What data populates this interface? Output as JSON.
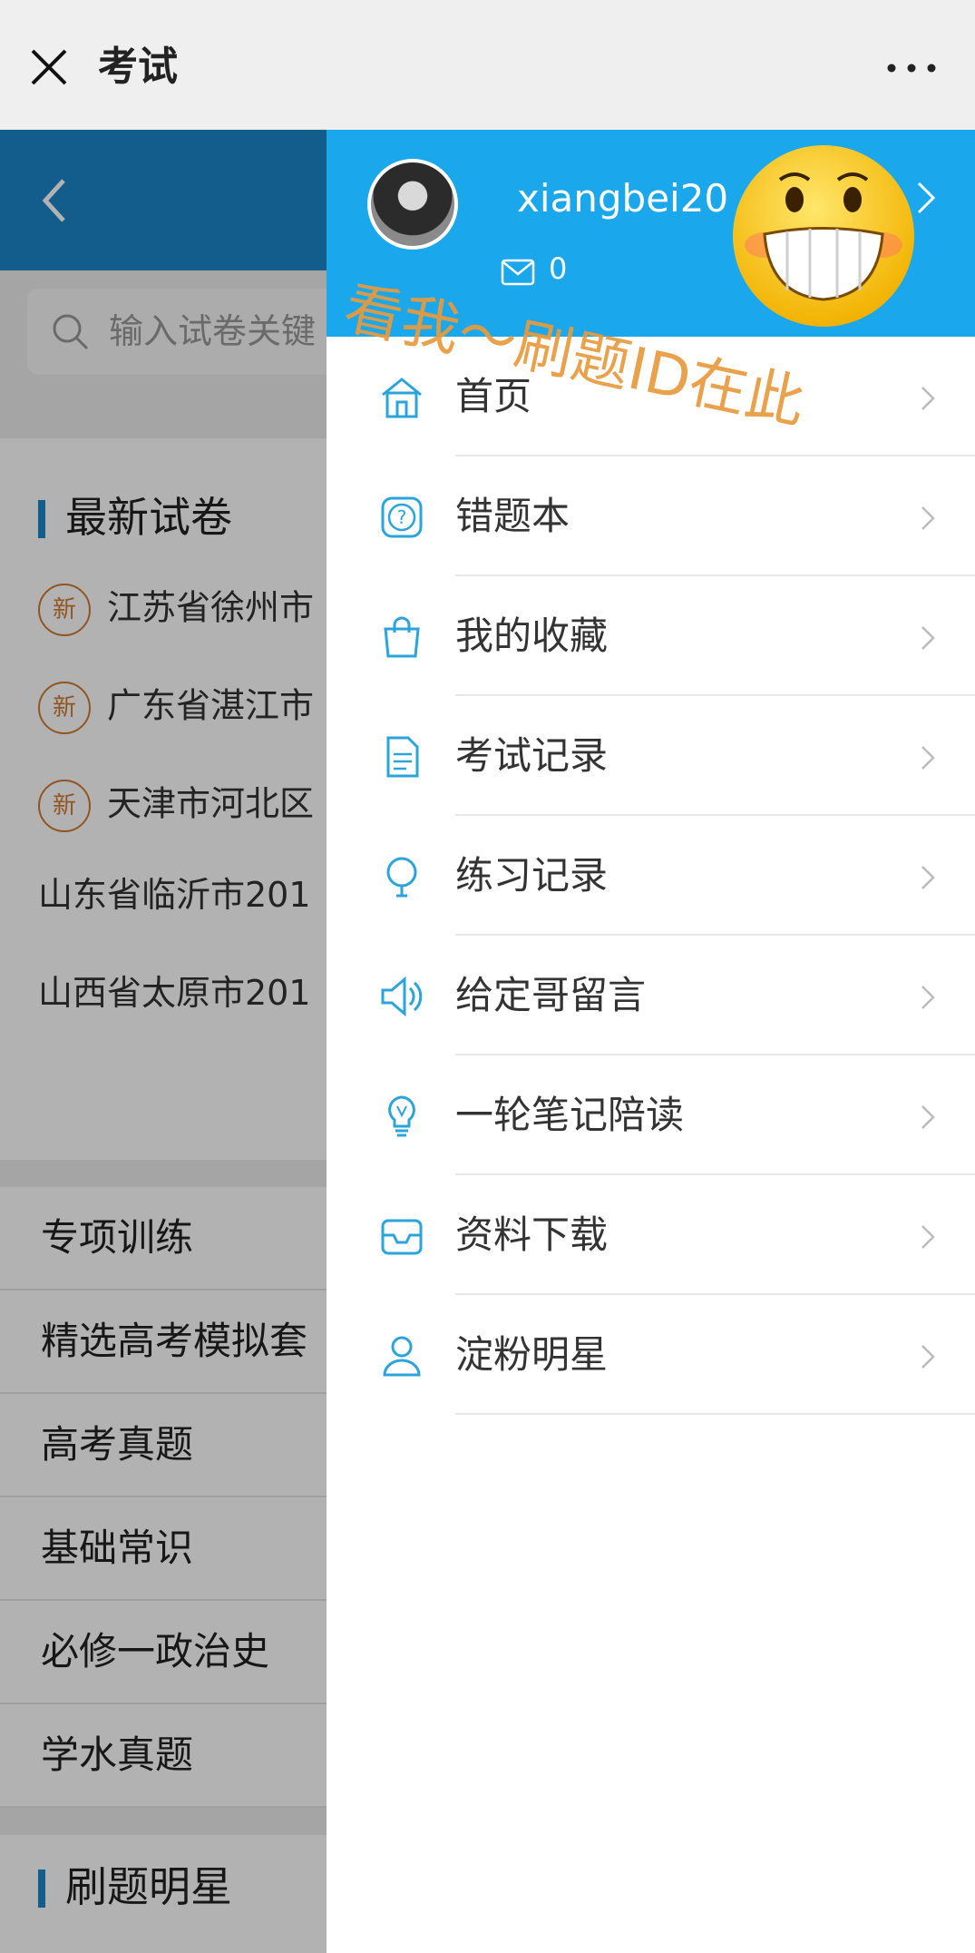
{
  "topbar": {
    "title": "考试"
  },
  "background": {
    "search_placeholder": "输入试卷关键",
    "latest_section_title": "最新试卷",
    "new_badge": "新",
    "papers": [
      {
        "text": "江苏省徐州市",
        "new": true
      },
      {
        "text": "广东省湛江市",
        "new": true
      },
      {
        "text": "天津市河北区",
        "new": true
      },
      {
        "text": "山东省临沂市201",
        "new": false
      },
      {
        "text": "山西省太原市201",
        "new": false
      }
    ],
    "categories": [
      "专项训练",
      "精选高考模拟套",
      "高考真题",
      "基础常识",
      "必修一政治史",
      "学水真题"
    ],
    "bottom_section_title": "刷题明星"
  },
  "drawer": {
    "username": "xiangbei20",
    "mail_count": "0",
    "menu": [
      {
        "label": "首页",
        "icon": "home-icon"
      },
      {
        "label": "错题本",
        "icon": "question-icon"
      },
      {
        "label": "我的收藏",
        "icon": "bag-icon"
      },
      {
        "label": "考试记录",
        "icon": "document-icon"
      },
      {
        "label": "练习记录",
        "icon": "bulb-icon"
      },
      {
        "label": "给定哥留言",
        "icon": "speaker-icon"
      },
      {
        "label": "一轮笔记陪读",
        "icon": "lightbulb-icon"
      },
      {
        "label": "资料下载",
        "icon": "inbox-icon"
      },
      {
        "label": "淀粉明星",
        "icon": "user-icon"
      }
    ]
  },
  "annotation": "看我～刷题ID在此",
  "colors": {
    "header_blue": "#1a86c7",
    "drawer_blue": "#1aa7ec",
    "icon_blue": "#2aa4da",
    "annotation_orange": "#e89a3c"
  }
}
